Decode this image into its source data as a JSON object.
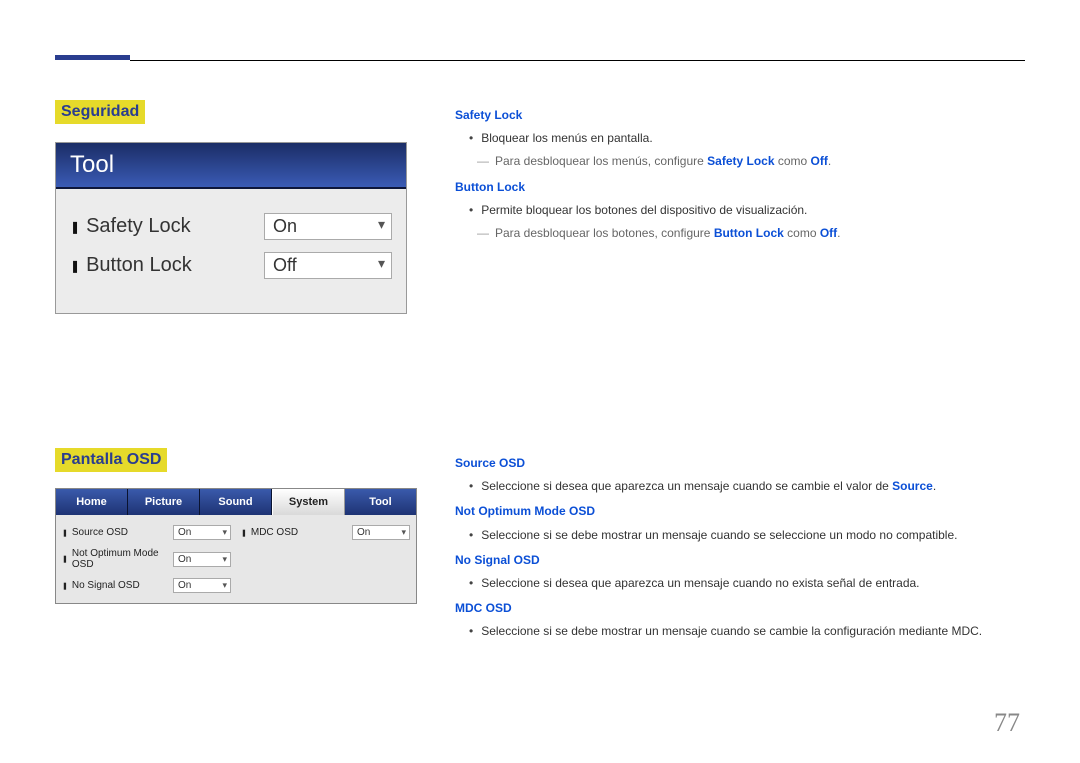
{
  "page_number": "77",
  "sections": {
    "seguridad": {
      "heading": "Seguridad",
      "tool_title": "Tool",
      "rows": [
        {
          "label": "Safety Lock",
          "value": "On"
        },
        {
          "label": "Button Lock",
          "value": "Off"
        }
      ],
      "safety_lock": {
        "title": "Safety Lock",
        "bullet": "Bloquear los menús en pantalla.",
        "note_pre": "Para desbloquear los menús, configure ",
        "note_strong1": "Safety Lock",
        "note_mid": " como ",
        "note_strong2": "Off",
        "note_post": "."
      },
      "button_lock": {
        "title": "Button Lock",
        "bullet": "Permite bloquear los botones del dispositivo de visualización.",
        "note_pre": "Para desbloquear los botones, configure ",
        "note_strong1": "Button Lock",
        "note_mid": " como ",
        "note_strong2": "Off",
        "note_post": "."
      }
    },
    "pantalla": {
      "heading": "Pantalla OSD",
      "tabs": [
        "Home",
        "Picture",
        "Sound",
        "System",
        "Tool"
      ],
      "active_tab": "System",
      "left_rows": [
        {
          "label": "Source OSD",
          "value": "On"
        },
        {
          "label": "Not Optimum Mode OSD",
          "value": "On"
        },
        {
          "label": "No Signal OSD",
          "value": "On"
        }
      ],
      "right_rows": [
        {
          "label": "MDC OSD",
          "value": "On"
        }
      ],
      "source_osd": {
        "title": "Source OSD",
        "bullet_pre": "Seleccione si desea que aparezca un mensaje cuando se cambie el valor de ",
        "bullet_strong": "Source",
        "bullet_post": "."
      },
      "not_optimum": {
        "title": "Not Optimum Mode OSD",
        "bullet": "Seleccione si se debe mostrar un mensaje cuando se seleccione un modo no compatible."
      },
      "no_signal": {
        "title": "No Signal OSD",
        "bullet": "Seleccione si desea que aparezca un mensaje cuando no exista señal de entrada."
      },
      "mdc_osd": {
        "title": "MDC OSD",
        "bullet": "Seleccione si se debe mostrar un mensaje cuando se cambie la configuración mediante MDC."
      }
    }
  }
}
